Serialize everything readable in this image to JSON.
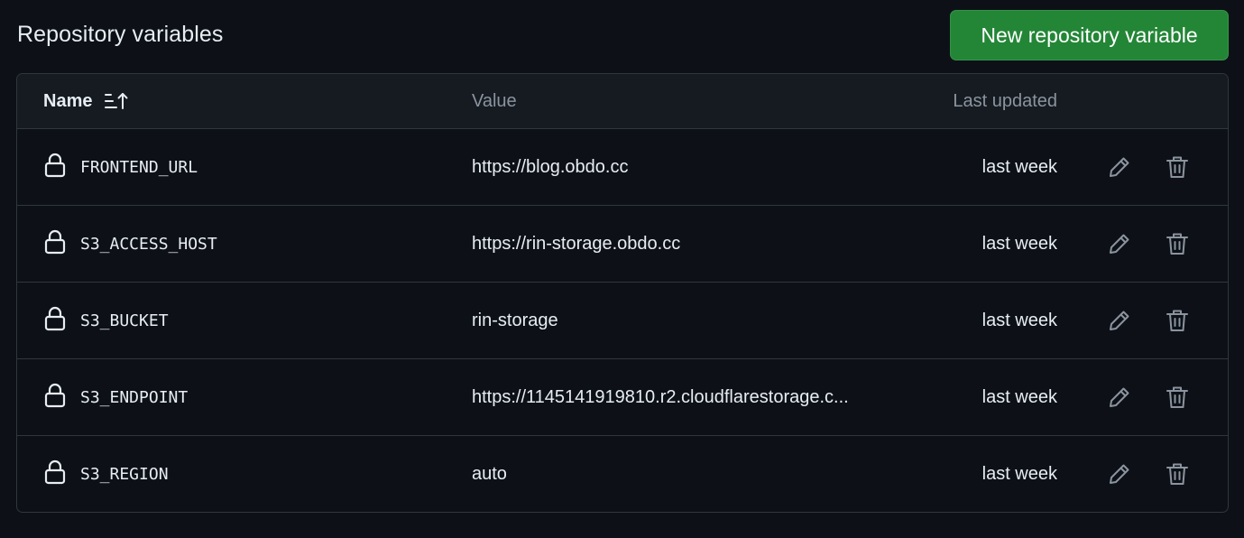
{
  "header": {
    "title": "Repository variables",
    "new_button_label": "New repository variable"
  },
  "table": {
    "columns": {
      "name": "Name",
      "value": "Value",
      "last_updated": "Last updated"
    },
    "sort_icon": "sort-ascending-icon",
    "rows": [
      {
        "name": "FRONTEND_URL",
        "value": "https://blog.obdo.cc",
        "updated": "last week"
      },
      {
        "name": "S3_ACCESS_HOST",
        "value": "https://rin-storage.obdo.cc",
        "updated": "last week"
      },
      {
        "name": "S3_BUCKET",
        "value": "rin-storage",
        "updated": "last week"
      },
      {
        "name": "S3_ENDPOINT",
        "value": "https://1145141919810.r2.cloudflarestorage.c...",
        "updated": "last week"
      },
      {
        "name": "S3_REGION",
        "value": "auto",
        "updated": "last week"
      }
    ],
    "row_icons": {
      "lock": "lock-icon",
      "edit": "pencil-icon",
      "delete": "trash-icon"
    }
  },
  "colors": {
    "background": "#0d1117",
    "header_bg": "#161b22",
    "border": "#30363d",
    "primary_button": "#238636",
    "muted_text": "#8b949e",
    "text": "#e6edf3"
  }
}
